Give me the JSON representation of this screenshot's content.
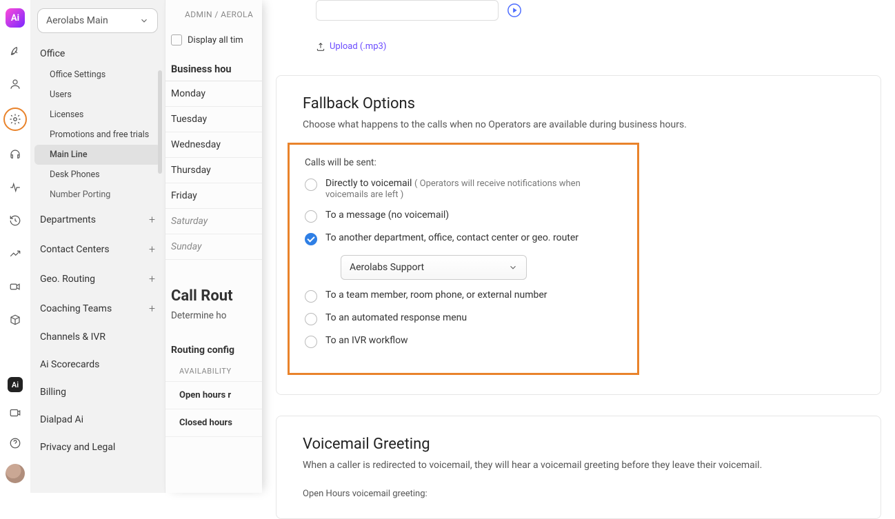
{
  "org": "Aerolabs Main",
  "breadcrumb": "ADMIN / AEROLA",
  "sidebar": {
    "section_office": "Office",
    "office_items": [
      "Office Settings",
      "Users",
      "Licenses",
      "Promotions and free trials",
      "Main Line",
      "Desk Phones",
      "Number Porting"
    ],
    "sections": [
      "Departments",
      "Contact Centers",
      "Geo. Routing",
      "Coaching Teams",
      "Channels & IVR",
      "Ai Scorecards",
      "Billing",
      "Dialpad Ai",
      "Privacy and Legal"
    ]
  },
  "mid": {
    "display_all": "Display all tim",
    "business_hours": "Business hou",
    "days": [
      "Monday",
      "Tuesday",
      "Wednesday",
      "Thursday",
      "Friday"
    ],
    "days_off": [
      "Saturday",
      "Sunday"
    ],
    "call_routing": "Call Rout",
    "cr_sub": "Determine ho",
    "routing_conf": "Routing config",
    "availability": "AVAILABILITY",
    "open_hours": "Open hours r",
    "closed_hours": "Closed hours"
  },
  "upload": {
    "link": "Upload (.mp3)"
  },
  "fallback": {
    "title": "Fallback Options",
    "subtitle": "Choose what happens to the calls when no Operators are available during business hours.",
    "label": "Calls will be sent:",
    "opts": {
      "voicemail": "Directly to voicemail",
      "voicemail_hint": "( Operators will receive notifications when voicemails are left )",
      "message": "To a message (no voicemail)",
      "another": "To another department, office, contact center or geo. router",
      "team": "To a team member, room phone, or external number",
      "auto": "To an automated response menu",
      "ivr": "To an IVR workflow"
    },
    "selected_dept": "Aerolabs Support"
  },
  "voicemail": {
    "title": "Voicemail Greeting",
    "sub": "When a caller is redirected to voicemail, they will hear a voicemail greeting before they leave their voicemail.",
    "open": "Open Hours voicemail greeting:"
  }
}
